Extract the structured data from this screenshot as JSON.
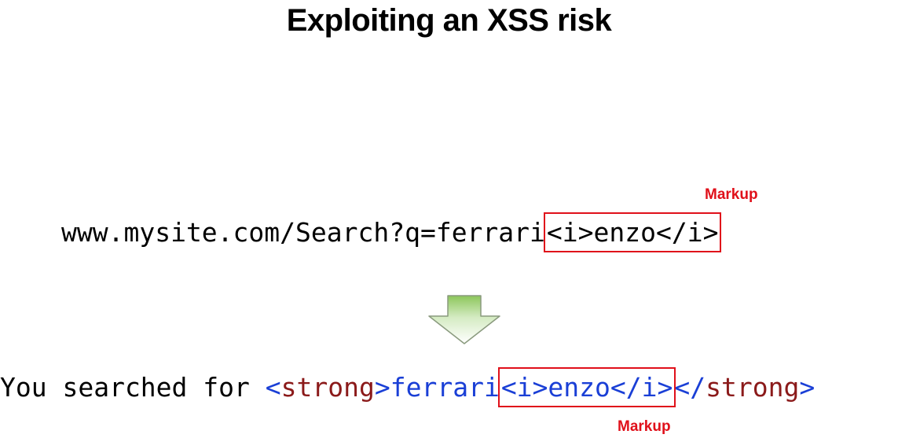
{
  "title": "Exploiting an XSS risk",
  "url_example": {
    "prefix": "www.mysite.com/Search?q=ferrari",
    "markup": "<i>enzo</i>"
  },
  "markup_label_top": "Markup",
  "markup_label_bottom": "Markup",
  "result": {
    "prefix": "You searched for ",
    "strong_open": "<strong>",
    "text": "ferrari",
    "markup": "<i>enzo</i>",
    "strong_close": "</strong>"
  },
  "colors": {
    "highlight": "#e0101a",
    "tag": "#8b1a1a",
    "content": "#1a3fd6",
    "arrow": "#8cc65a"
  },
  "icons": {
    "arrow": "down-arrow-icon"
  }
}
